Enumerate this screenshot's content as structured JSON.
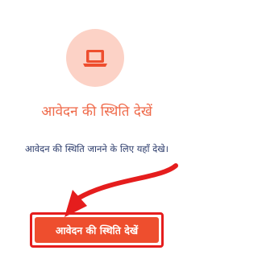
{
  "icon": {
    "name": "laptop-icon",
    "circle_color": "#fcd2c6",
    "icon_color": "#ee4e2e"
  },
  "heading": "आवेदन की स्थिति देखें",
  "description": "आवेदन की स्थिति जानने के लिए यहाँ देखे।",
  "button": {
    "label": "आवेदन की स्थिति देखें"
  },
  "colors": {
    "accent": "#ee4e2e",
    "heading": "#ef6a4a",
    "highlight": "#e51d1d",
    "text": "#2a3a6a"
  }
}
